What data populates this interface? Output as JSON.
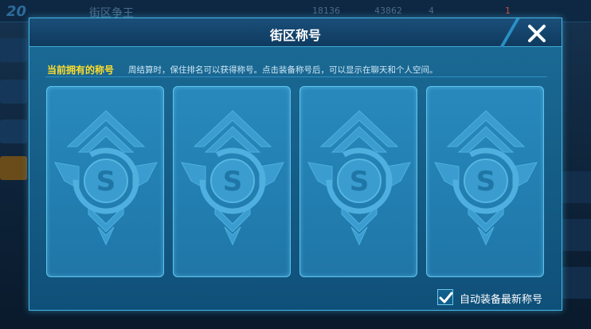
{
  "background": {
    "logo": "20",
    "title": "街区争王",
    "resources": [
      "18136",
      "43862",
      "4"
    ],
    "badge": "1"
  },
  "dialog": {
    "title": "街区称号",
    "close_icon": "close-icon"
  },
  "info": {
    "label": "当前拥有的称号",
    "description": "周结算时，保住排名可以获得称号。点击装备称号后，可以显示在聊天和个人空间。"
  },
  "title_slots": [
    {
      "icon": "s-emblem-icon",
      "state": "empty"
    },
    {
      "icon": "s-emblem-icon",
      "state": "empty"
    },
    {
      "icon": "s-emblem-icon",
      "state": "empty"
    },
    {
      "icon": "s-emblem-icon",
      "state": "empty"
    }
  ],
  "auto_equip": {
    "label": "自动装备最新称号",
    "checked": true
  },
  "colors": {
    "accent_yellow": "#ffdc2a",
    "panel_blue": "#1b6c97",
    "card_blue": "#2889bd",
    "border_cyan": "#47b7e6"
  }
}
